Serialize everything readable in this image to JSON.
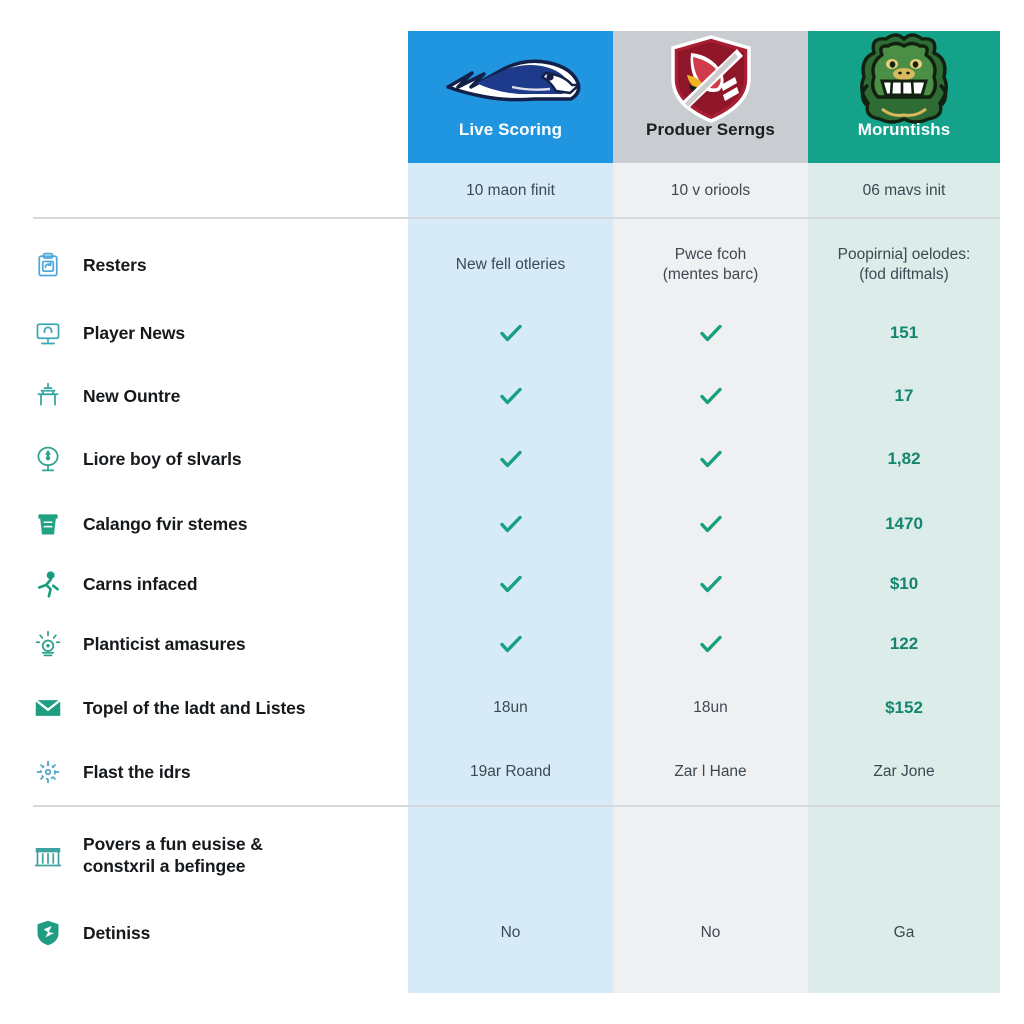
{
  "columns": [
    {
      "id": "col-live-scoring",
      "title": "Live Scoring",
      "subtitle": "10 maon finit",
      "header_bg": "#2196e0",
      "band_bg": "#d6eaf8",
      "logo": "eagle-mascot-logo"
    },
    {
      "id": "col-produer-serngs",
      "title": "Produer Serngs",
      "subtitle": "10 v oriools",
      "header_bg": "#c9cdd1",
      "band_bg": "#eff0f2",
      "logo": "shield-crest-logo"
    },
    {
      "id": "col-moruntishs",
      "title": "Moruntishs",
      "subtitle": "06 mavs init",
      "header_bg": "#14a38a",
      "band_bg": "#dcece8",
      "logo": "gator-mascot-logo"
    }
  ],
  "rows": [
    {
      "label": "Resters",
      "icon": "clipboard-refresh-icon",
      "cells": [
        "New fell otleries",
        "Pwce fcoh\n(mentes barc)",
        "Poopirnia] oelodes:\n(fod diftmals)"
      ],
      "kinds": [
        "text",
        "text",
        "text"
      ]
    },
    {
      "label": "Player News",
      "icon": "monitor-icon",
      "cells": [
        "check",
        "check",
        "151"
      ],
      "kinds": [
        "check",
        "check",
        "accent"
      ]
    },
    {
      "label": "New Ountre",
      "icon": "table-lamp-icon",
      "cells": [
        "check",
        "check",
        "17"
      ],
      "kinds": [
        "check",
        "check",
        "accent"
      ]
    },
    {
      "label": "Liore boy of slvarls",
      "icon": "microscope-circle-icon",
      "cells": [
        "check",
        "check",
        "1,82"
      ],
      "kinds": [
        "check",
        "check",
        "accent"
      ]
    },
    {
      "label": "Calango fvir stemes",
      "icon": "cup-drink-icon",
      "cells": [
        "check",
        "check",
        "1470"
      ],
      "kinds": [
        "check",
        "check",
        "accent"
      ]
    },
    {
      "label": "Carns infaced",
      "icon": "running-person-icon",
      "cells": [
        "check",
        "check",
        "$10"
      ],
      "kinds": [
        "check",
        "check",
        "accent"
      ]
    },
    {
      "label": "Planticist amasures",
      "icon": "idea-bulb-icon",
      "cells": [
        "check",
        "check",
        "122"
      ],
      "kinds": [
        "check",
        "check",
        "accent"
      ]
    },
    {
      "label": "Topel of the ladt and Listes",
      "icon": "envelope-icon",
      "cells": [
        "18un",
        "18un",
        "$152"
      ],
      "kinds": [
        "text",
        "text",
        "accent"
      ]
    },
    {
      "label": "Flast the idrs",
      "icon": "network-nodes-icon",
      "cells": [
        "19ar Roand",
        "Zar l Hane",
        "Zar Jone"
      ],
      "kinds": [
        "text",
        "text",
        "text"
      ]
    },
    {
      "label": "Povers a fun eusise &\nconstxril a befingee",
      "icon": "bank-building-icon",
      "cells": [
        "",
        "",
        ""
      ],
      "kinds": [
        "text",
        "text",
        "text"
      ]
    },
    {
      "label": "Detiniss",
      "icon": "shield-icon",
      "cells": [
        "No",
        "No",
        "Ga"
      ],
      "kinds": [
        "text",
        "text",
        "text"
      ]
    }
  ],
  "colors": {
    "check": "#18a07f",
    "accent_text": "#14866f",
    "body_text": "#3d4852",
    "label_text": "#16191c",
    "divider": "#d6d9dc"
  }
}
